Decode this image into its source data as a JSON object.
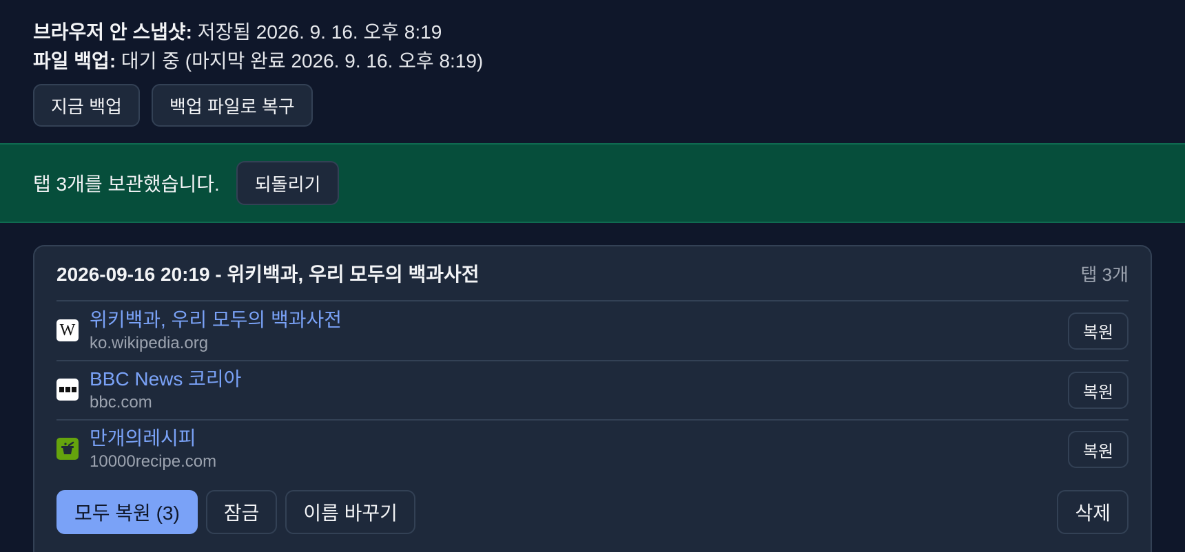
{
  "status": {
    "snapshot_label": "브라우저 안 스냅샷:",
    "snapshot_value": " 저장됨 2026. 9. 16. 오후 8:19",
    "backup_label": "파일 백업:",
    "backup_value": " 대기 중 (마지막 완료 2026. 9. 16. 오후 8:19)"
  },
  "top_actions": {
    "backup_now": "지금 백업",
    "restore_from_file": "백업 파일로 복구"
  },
  "banner": {
    "message": "탭 3개를 보관했습니다.",
    "undo": "되돌리기",
    "color": "#064e3b"
  },
  "session": {
    "title": "2026-09-16 20:19 - 위키백과, 우리 모두의 백과사전",
    "tab_count": "탭 3개",
    "tabs": [
      {
        "title": "위키백과, 우리 모두의 백과사전",
        "url": "ko.wikipedia.org",
        "icon": "wikipedia-icon",
        "favicon_glyph": "W",
        "restore": "복원"
      },
      {
        "title": "BBC News 코리아",
        "url": "bbc.com",
        "icon": "bbc-icon",
        "restore": "복원"
      },
      {
        "title": "만개의레시피",
        "url": "10000recipe.com",
        "icon": "recipe-pot-icon",
        "restore": "복원"
      }
    ],
    "actions": {
      "restore_all": "모두 복원 (3)",
      "lock": "잠금",
      "rename": "이름 바꾸기",
      "delete": "삭제"
    }
  },
  "colors": {
    "background": "#0f172a",
    "card": "#1e293b",
    "accent": "#7aa2f7",
    "link": "#7aa2f7"
  }
}
